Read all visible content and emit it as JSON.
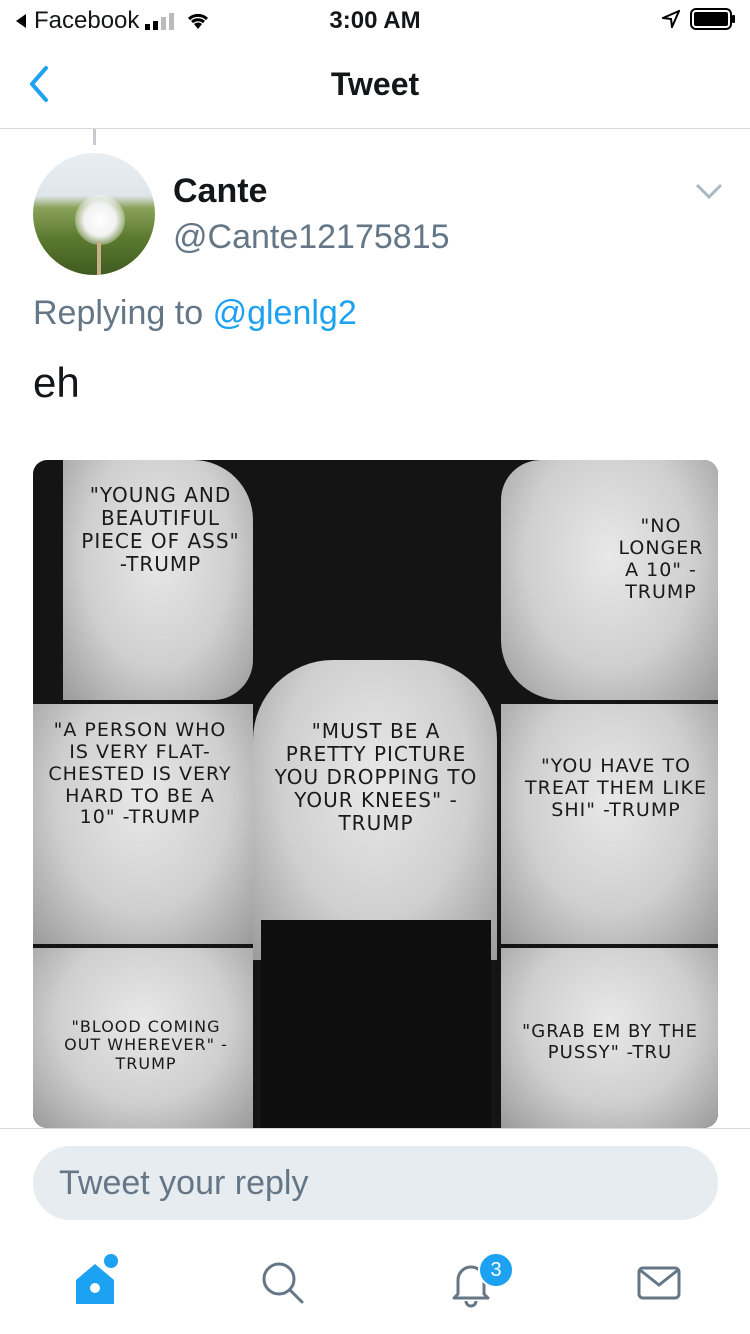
{
  "status_bar": {
    "back_app": "Facebook",
    "time": "3:00 AM"
  },
  "nav": {
    "title": "Tweet"
  },
  "tweet": {
    "display_name": "Cante",
    "handle": "@Cante12175815",
    "replying_prefix": "Replying to",
    "replying_to": "@glenlg2",
    "text": "eh"
  },
  "media_text": {
    "p1": "\"YOUNG AND BEAUTIFUL PIECE OF ASS\" -TRUMP",
    "p2": "\"NO LONGER A 10\" -TRUMP",
    "p3": "\"A PERSON WHO IS VERY FLAT-CHESTED IS VERY HARD TO BE A 10\" -TRUMP",
    "p4": "\"MUST BE A PRETTY PICTURE YOU DROPPING TO YOUR KNEES\" -TRUMP",
    "p5": "\"YOU HAVE TO TREAT THEM LIKE SHI\" -TRUMP",
    "p6": "\"BLOOD COMING OUT WHEREVER\" -TRUMP",
    "p7": "\"GRAB EM BY THE PUSSY\" -TRU"
  },
  "reply": {
    "placeholder": "Tweet your reply"
  },
  "tabs": {
    "notifications_badge": "3"
  },
  "colors": {
    "accent": "#1da1f2",
    "secondary_text": "#657786",
    "reply_bg": "#e6ecf0"
  }
}
